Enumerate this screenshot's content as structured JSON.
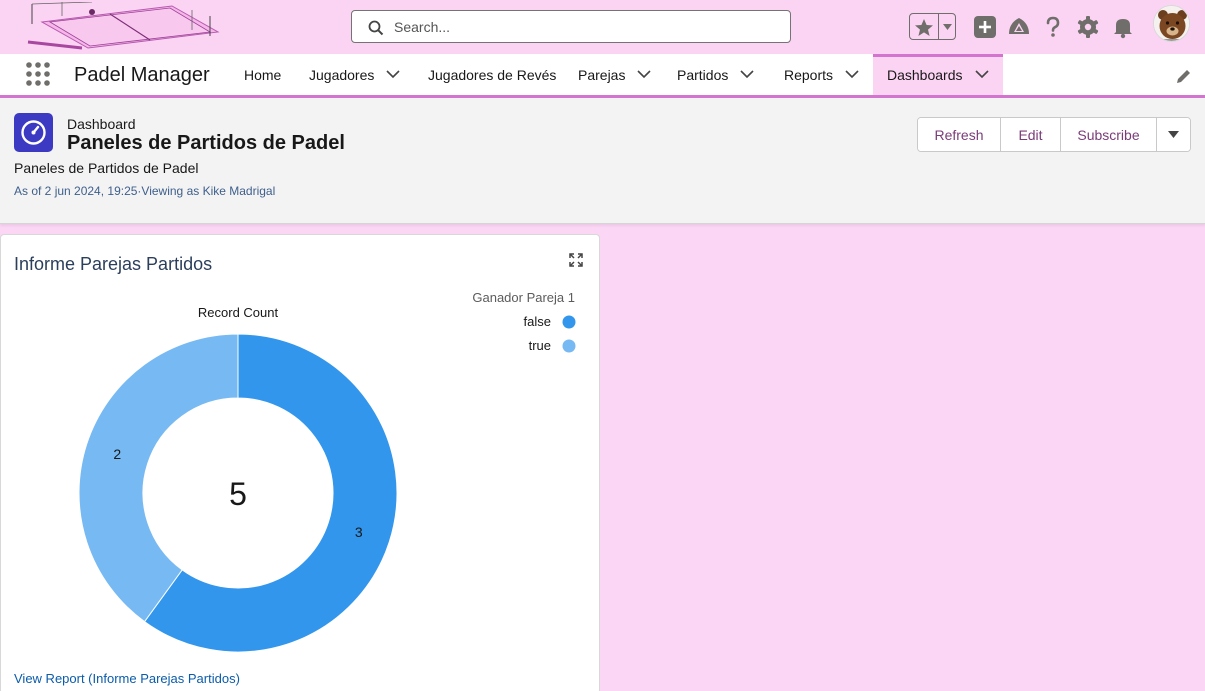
{
  "global_header": {
    "search_placeholder": "Search...",
    "icons": [
      "favorites-star-icon",
      "favorites-list-caret-icon",
      "global-add-icon",
      "trailhead-guidance-icon",
      "help-icon",
      "setup-gear-icon",
      "notifications-bell-icon"
    ],
    "accent_color": "#fcd4f3"
  },
  "nav": {
    "app_name": "Padel Manager",
    "items": [
      {
        "label": "Home",
        "has_menu": false
      },
      {
        "label": "Jugadores",
        "has_menu": true
      },
      {
        "label": "Jugadores de Revés",
        "has_menu": false
      },
      {
        "label": "Parejas",
        "has_menu": true
      },
      {
        "label": "Partidos",
        "has_menu": true
      },
      {
        "label": "Reports",
        "has_menu": true
      },
      {
        "label": "Dashboards",
        "has_menu": true,
        "active": true
      }
    ],
    "active_color": "#d374cf"
  },
  "dashboard": {
    "type_label": "Dashboard",
    "title": "Paneles de Partidos de Padel",
    "description": "Paneles de Partidos de Padel",
    "meta": "As of 2 jun 2024, 19:25·Viewing as Kike Madrigal",
    "buttons": {
      "refresh": "Refresh",
      "edit": "Edit",
      "subscribe": "Subscribe"
    }
  },
  "widget": {
    "title": "Informe Parejas Partidos",
    "view_report_link": "View Report (Informe Parejas Partidos)"
  },
  "chart_data": {
    "type": "pie",
    "variant": "donut",
    "title": "Record Count",
    "center_total": "5",
    "legend_title": "Ganador Pareja 1",
    "legend_position": "top-right",
    "categories": [
      "false",
      "true"
    ],
    "values": [
      3,
      2
    ],
    "colors": [
      "#3296ed",
      "#77b9f2"
    ]
  }
}
